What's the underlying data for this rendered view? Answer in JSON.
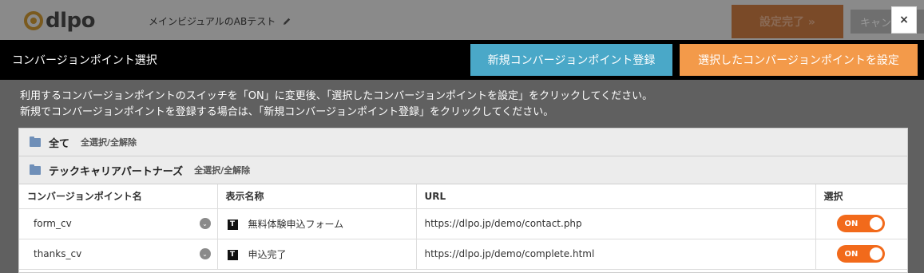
{
  "app": {
    "logo_text": "dlpo",
    "test_name": "メインビジュアルのABテスト",
    "done_button": "設定完了 »",
    "cancel_button": "キャンセル",
    "close_symbol": "×"
  },
  "modal": {
    "title": "コンバージョンポイント選択",
    "register_button": "新規コンバージョンポイント登録",
    "set_button": "選択したコンバージョンポイントを設定",
    "instructions": [
      "利用するコンバージョンポイントのスイッチを「ON」に変更後、「選択したコンバージョンポイントを設定」をクリックしてください。",
      "新規でコンバージョンポイントを登録する場合は、「新規コンバージョンポイント登録」をクリックしてください。"
    ]
  },
  "groups": [
    {
      "label": "全て",
      "select_all": "全選択/全解除"
    },
    {
      "label": "テックキャリアパートナーズ",
      "select_all": "全選択/全解除"
    }
  ],
  "table": {
    "headers": [
      "コンバージョンポイント名",
      "表示名称",
      "URL",
      "選択"
    ],
    "rows": [
      {
        "cv_name": "form_cv",
        "display_name": "無料体験申込フォーム",
        "url": "https://dlpo.jp/demo/contact.php",
        "toggle": "ON"
      },
      {
        "cv_name": "thanks_cv",
        "display_name": "申込完了",
        "url": "https://dlpo.jp/demo/complete.html",
        "toggle": "ON"
      }
    ]
  },
  "colors": {
    "register_button": "#4aa8c8",
    "set_button": "#f39a4a",
    "toggle_on": "#f26a1b"
  },
  "icons": {
    "text_icon_glyph": "T",
    "chevron_glyph": "⌄"
  }
}
